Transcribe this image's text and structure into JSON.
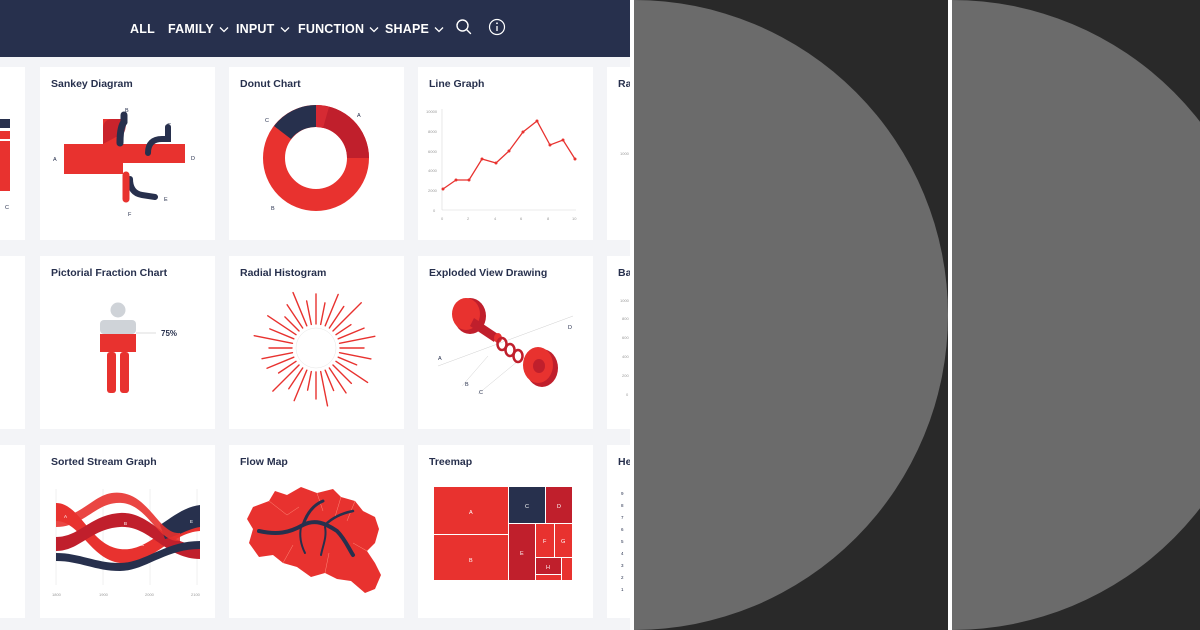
{
  "nav": {
    "items": [
      {
        "label": "ALL",
        "dropdown": false
      },
      {
        "label": "FAMILY",
        "dropdown": true
      },
      {
        "label": "INPUT",
        "dropdown": true
      },
      {
        "label": "FUNCTION",
        "dropdown": true
      },
      {
        "label": "SHAPE",
        "dropdown": true
      }
    ],
    "icons": [
      "search-icon",
      "info-icon"
    ]
  },
  "cards": [
    {
      "title": "Sankey Diagram",
      "labels": [
        "A",
        "B",
        "C",
        "D",
        "E",
        "F"
      ]
    },
    {
      "title": "Donut Chart",
      "labels": [
        "A",
        "B",
        "C"
      ]
    },
    {
      "title": "Line Graph",
      "y_ticks": [
        "10000",
        "8000",
        "6000",
        "4000",
        "2000",
        "0"
      ],
      "x_ticks": [
        "0",
        "2",
        "4",
        "6",
        "8",
        "10"
      ]
    },
    {
      "title": "Ra",
      "y_ticks": [
        "1000"
      ]
    },
    {
      "title": "Pictorial Fraction Chart",
      "value_label": "75%"
    },
    {
      "title": "Radial Histogram"
    },
    {
      "title": "Exploded View Drawing",
      "labels": [
        "A",
        "B",
        "C",
        "D"
      ]
    },
    {
      "title": "Ba",
      "y_ticks": [
        "1000",
        "800",
        "600",
        "400",
        "200",
        "0"
      ]
    },
    {
      "title": "Sorted Stream Graph",
      "labels": [
        "A",
        "B",
        "C",
        "D",
        "E"
      ],
      "x_ticks": [
        "1800",
        "1900",
        "2000",
        "2100"
      ]
    },
    {
      "title": "Flow Map"
    },
    {
      "title": "Treemap",
      "labels": [
        "A",
        "B",
        "C",
        "D",
        "E",
        "F",
        "G",
        "H"
      ]
    },
    {
      "title": "He",
      "y_ticks": [
        "9",
        "8",
        "7",
        "6",
        "5",
        "4",
        "3",
        "2",
        "1"
      ]
    }
  ],
  "left_edge_labels": [
    "C"
  ],
  "colors": {
    "navy": "#27304d",
    "red": "#e8322f",
    "dark_red": "#c01f2c",
    "background": "#f3f4f7",
    "panel_dark": "#292929",
    "panel_circle": "#6b6b6b"
  }
}
